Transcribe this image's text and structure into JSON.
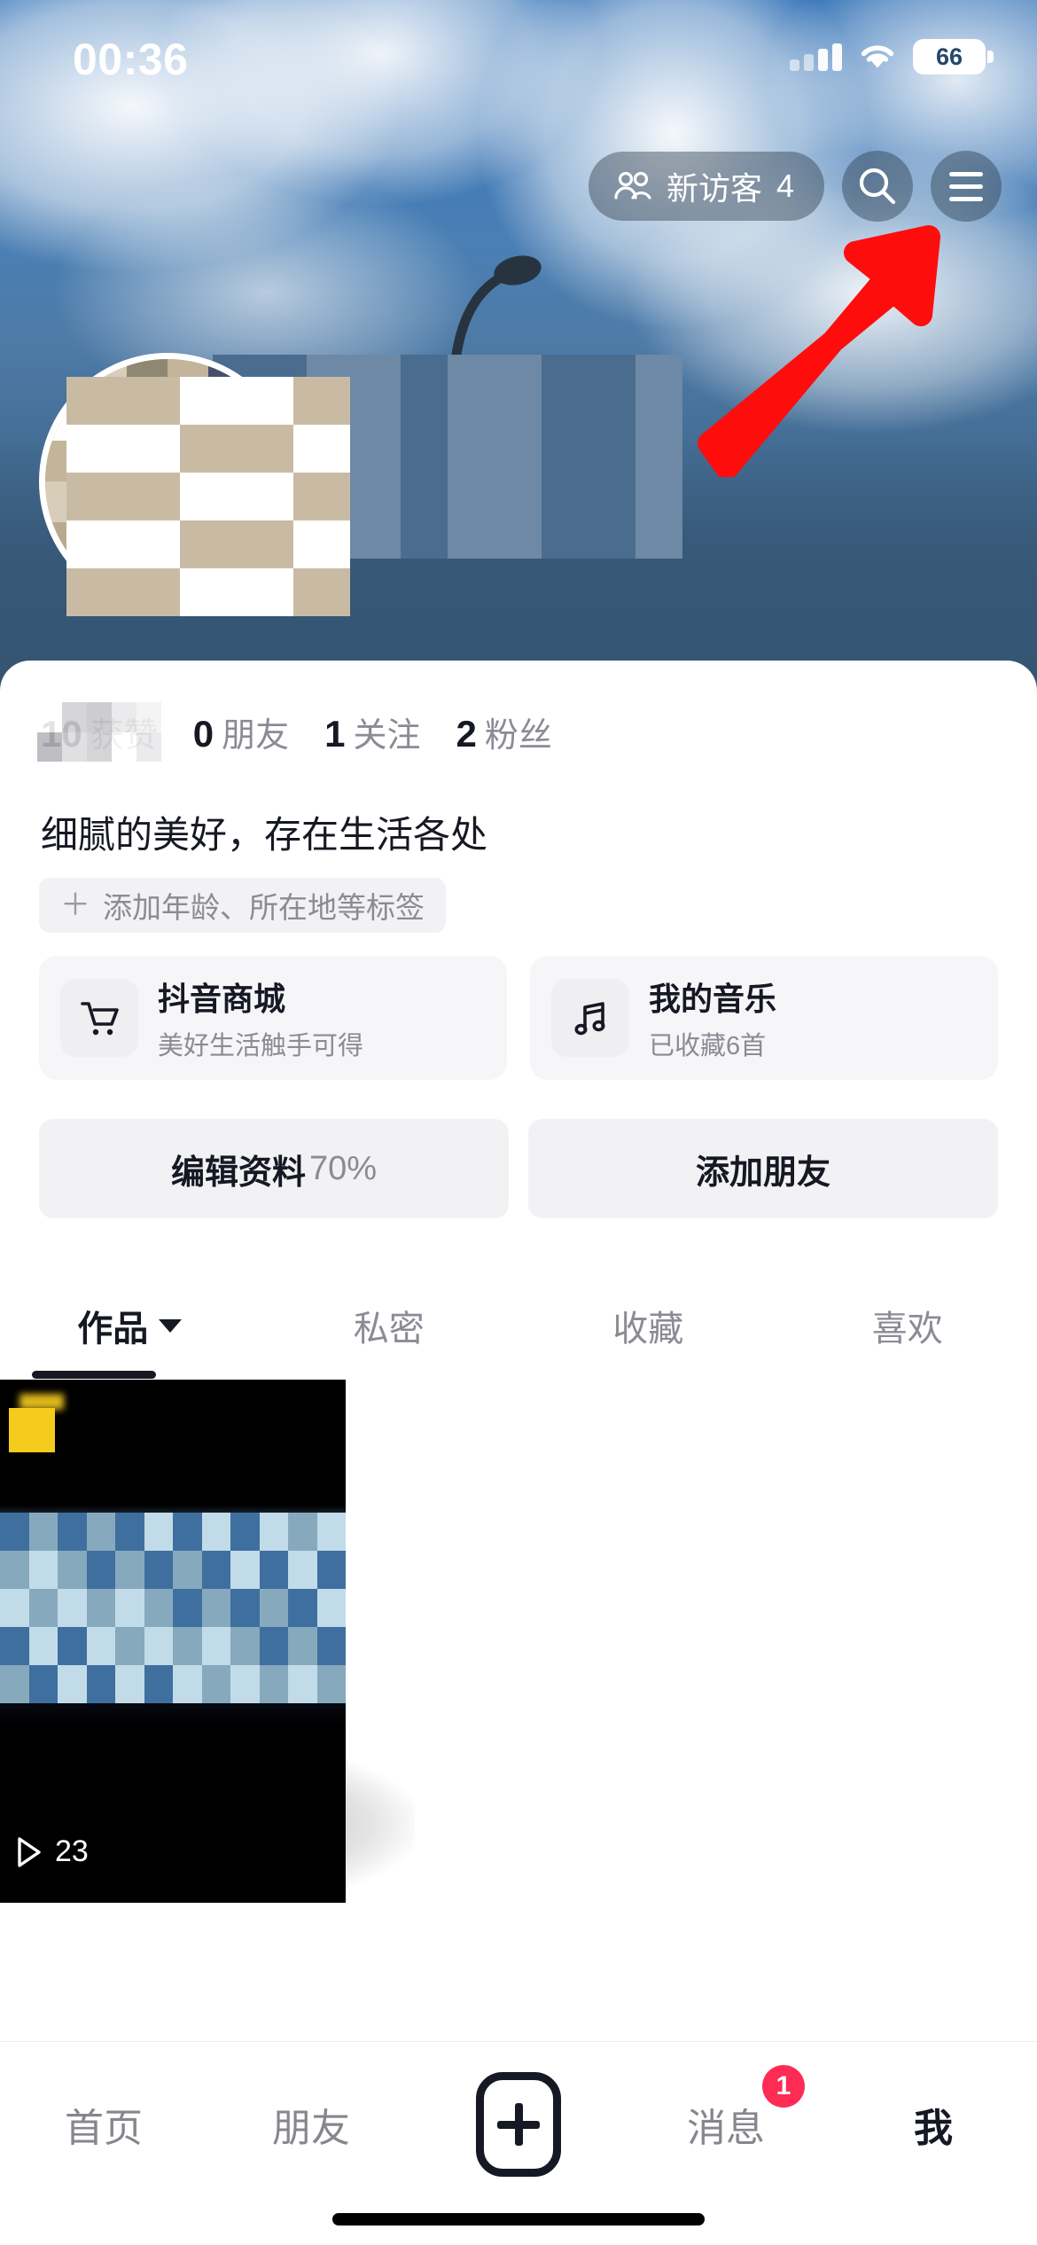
{
  "status_bar": {
    "time": "00:36",
    "cellular_icon": "signal-bars-icon",
    "wifi_icon": "wifi-icon",
    "battery_level": "66"
  },
  "cover": {
    "description": "sky-with-clouds-cover-photo",
    "lamp_icon": "street-lamp",
    "bg_color": "#355573"
  },
  "annotation": {
    "arrow_icon": "red-arrow-up-right",
    "color": "#FF0D0D",
    "points_to": "menu-button"
  },
  "top_actions": {
    "visitors_icon": "people-icon",
    "visitors_label": "新访客",
    "visitors_count": "4",
    "search_icon": "search-icon",
    "menu_icon": "hamburger-menu-icon"
  },
  "profile": {
    "avatar_icon": "user-avatar",
    "stats": [
      {
        "num": "10",
        "label": "获赞",
        "masked": true
      },
      {
        "num": "0",
        "label": "朋友",
        "masked": false
      },
      {
        "num": "1",
        "label": "关注",
        "masked": false
      },
      {
        "num": "2",
        "label": "粉丝",
        "masked": false
      }
    ],
    "bio": "细腻的美好，存在生活各处",
    "add_tag_plus": "＋",
    "add_tag_label": "添加年龄、所在地等标签"
  },
  "entry_cards": [
    {
      "icon": "shopping-cart-icon",
      "title": "抖音商城",
      "subtitle": "美好生活触手可得"
    },
    {
      "icon": "music-note-icon",
      "title": "我的音乐",
      "subtitle": "已收藏6首"
    }
  ],
  "action_buttons": {
    "edit_profile_label": "编辑资料",
    "edit_profile_percent": "70%",
    "add_friend_label": "添加朋友"
  },
  "content_tabs": [
    {
      "label": "作品",
      "active": true,
      "has_caret": true
    },
    {
      "label": "私密",
      "active": false,
      "has_caret": false
    },
    {
      "label": "收藏",
      "active": false,
      "has_caret": false
    },
    {
      "label": "喜欢",
      "active": false,
      "has_caret": false
    }
  ],
  "video_grid": [
    {
      "play_icon": "play-triangle-icon",
      "play_count": "23",
      "badge_color": "#F5CB1E",
      "thumbnail": "beach-sunset-video-thumbnail"
    }
  ],
  "bottom_nav": [
    {
      "label": "首页",
      "active": false,
      "type": "text"
    },
    {
      "label": "朋友",
      "active": false,
      "type": "text"
    },
    {
      "label": "",
      "active": false,
      "type": "plus-button",
      "icon": "plus-icon"
    },
    {
      "label": "消息",
      "active": false,
      "type": "text",
      "badge": "1"
    },
    {
      "label": "我",
      "active": true,
      "type": "text"
    }
  ],
  "colors": {
    "accent_red": "#FE2C55",
    "text_primary": "#161823",
    "text_secondary": "#8A8B94",
    "chip_bg": "#F2F2F4"
  }
}
